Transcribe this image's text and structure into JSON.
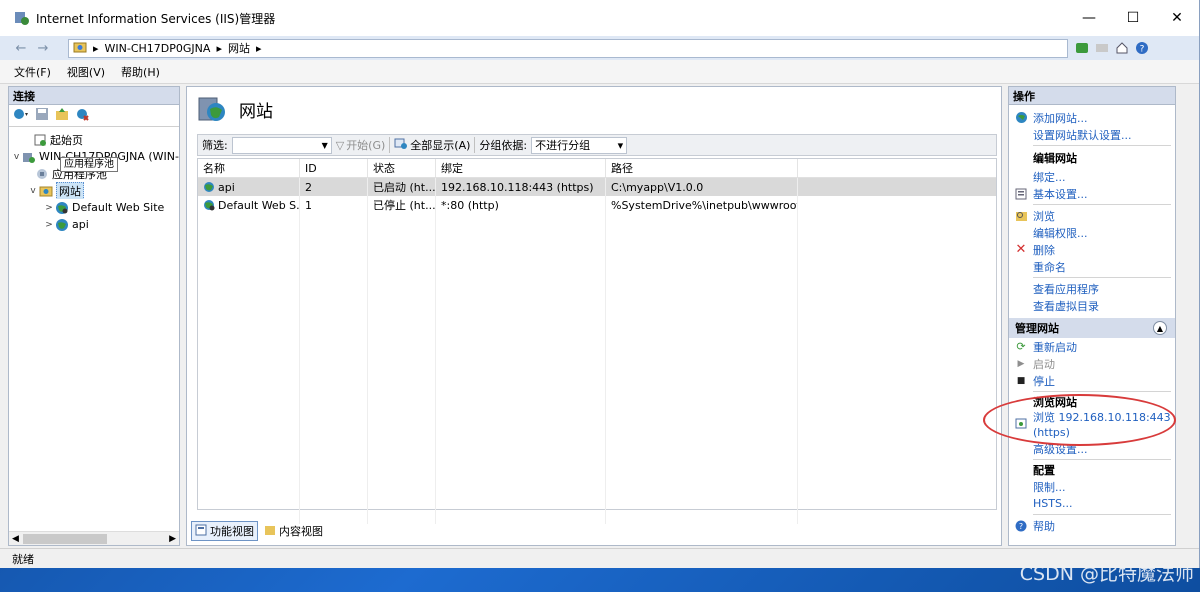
{
  "window": {
    "title": "Internet Information Services (IIS)管理器",
    "minimize_glyph": "—",
    "maximize_glyph": "☐",
    "close_glyph": "✕"
  },
  "address": {
    "back_glyph": "←",
    "forward_glyph": "→",
    "segments": [
      "WIN-CH17DP0GJNA",
      "网站"
    ],
    "arrow": "▸"
  },
  "menu": {
    "items": [
      "文件(F)",
      "视图(V)",
      "帮助(H)"
    ]
  },
  "connections": {
    "header": "连接",
    "tree": [
      {
        "label": "起始页",
        "icon": "start-page-icon",
        "expand": ""
      },
      {
        "label": "WIN-CH17DP0GJNA (WIN-",
        "icon": "server-icon",
        "expand": "v"
      },
      {
        "label": "应用程序池",
        "icon": "app-pools-icon",
        "expand": ""
      },
      {
        "label": "网站",
        "icon": "sites-folder-icon",
        "expand": "v"
      },
      {
        "label": "Default Web Site",
        "icon": "globe-icon",
        "expand": ">"
      },
      {
        "label": "api",
        "icon": "globe-icon",
        "expand": ">"
      }
    ],
    "tooltip": "应用程序池"
  },
  "center": {
    "title": "网站",
    "filter": {
      "label": "筛选:",
      "go_label": "开始(G)",
      "show_all_label": "全部显示(A)",
      "group_label": "分组依据:",
      "group_value": "不进行分组"
    },
    "columns": [
      "名称",
      "ID",
      "状态",
      "绑定",
      "路径"
    ],
    "rows": [
      {
        "name": "api",
        "id": "2",
        "status": "已启动 (ht...",
        "binding": "192.168.10.118:443 (https)",
        "path": "C:\\myapp\\V1.0.0"
      },
      {
        "name": "Default Web S...",
        "id": "1",
        "status": "已停止 (ht...",
        "binding": "*:80 (http)",
        "path": "%SystemDrive%\\inetpub\\wwwroot"
      }
    ],
    "view_tabs": [
      "功能视图",
      "内容视图"
    ]
  },
  "actions": {
    "header": "操作",
    "top": [
      {
        "label": "添加网站...",
        "icon": "add-site-icon"
      },
      {
        "label": "设置网站默认设置...",
        "icon": ""
      }
    ],
    "edit_title": "编辑网站",
    "edit": [
      {
        "label": "绑定...",
        "icon": ""
      },
      {
        "label": "基本设置...",
        "icon": "settings-icon"
      }
    ],
    "browse_group": [
      {
        "label": "浏览",
        "icon": "explore-icon"
      },
      {
        "label": "编辑权限...",
        "icon": ""
      },
      {
        "label": "删除",
        "icon": "delete-icon"
      },
      {
        "label": "重命名",
        "icon": ""
      }
    ],
    "app_group": [
      {
        "label": "查看应用程序",
        "icon": ""
      },
      {
        "label": "查看虚拟目录",
        "icon": ""
      }
    ],
    "manage_title": "管理网站",
    "manage": [
      {
        "label": "重新启动",
        "icon": "restart-icon",
        "disabled": false
      },
      {
        "label": "启动",
        "icon": "start-icon",
        "disabled": true
      },
      {
        "label": "停止",
        "icon": "stop-icon",
        "disabled": false
      }
    ],
    "browse_site_title": "浏览网站",
    "browse_site_link": "浏览 192.168.10.118:443",
    "browse_site_link2": "(https)",
    "advanced": "高级设置...",
    "config_title": "配置",
    "config": [
      "限制...",
      "HSTS..."
    ],
    "help": "帮助"
  },
  "status": {
    "text": "就绪"
  },
  "watermark": "CSDN @比特魔法师",
  "colors": {
    "link": "#1f5fbf",
    "highlight": "#d83b3b",
    "pane_header": "#d4dceb"
  }
}
